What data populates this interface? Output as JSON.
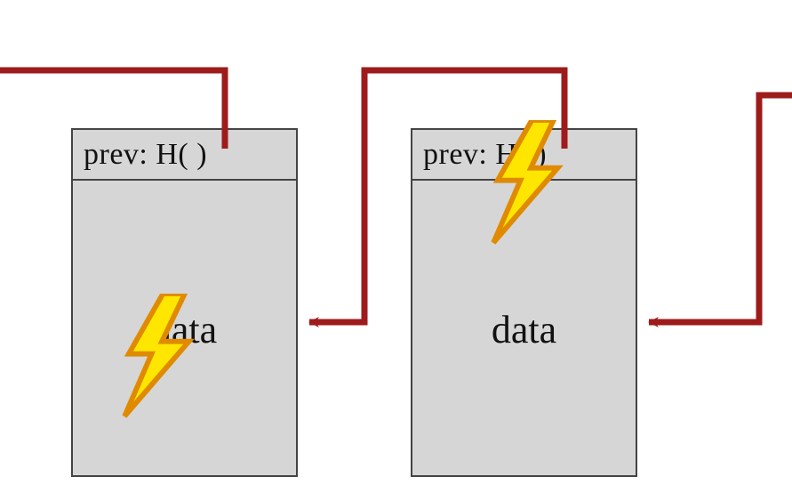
{
  "diagram": {
    "blocks": [
      {
        "header": "prev: H(   )",
        "body": "data"
      },
      {
        "header": "prev: H(   )",
        "body": "data"
      }
    ],
    "colors": {
      "block_fill": "#d6d6d6",
      "block_border": "#444444",
      "wire": "#9e1b1b",
      "bolt_fill": "#ffe600",
      "bolt_stroke": "#e08a00"
    }
  }
}
